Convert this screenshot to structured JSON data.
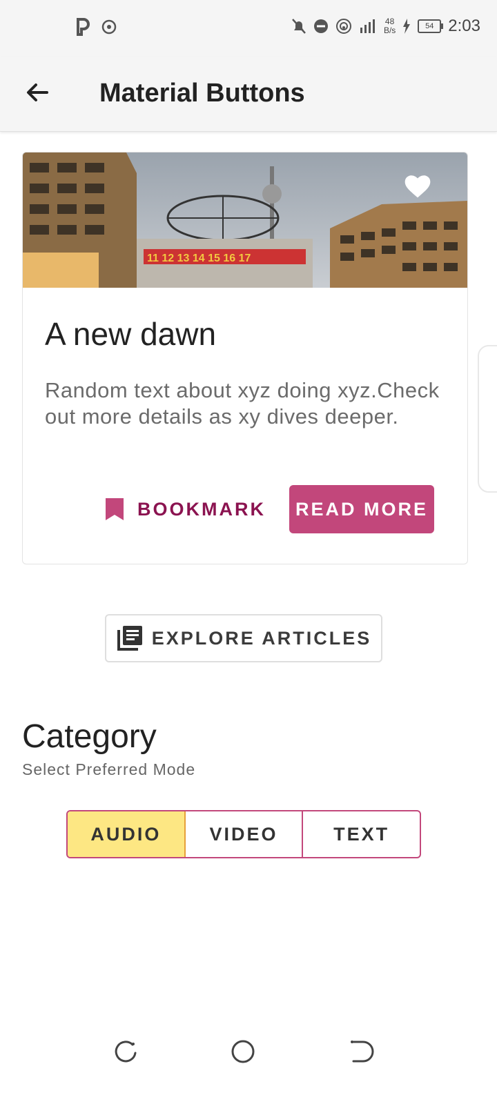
{
  "status_bar": {
    "time": "2:03",
    "speed_value": "48",
    "speed_unit": "B/s",
    "battery": "54"
  },
  "app_bar": {
    "title": "Material Buttons"
  },
  "card": {
    "title": "A new dawn",
    "body": "Random text about xyz doing xyz.Check out more details as xy dives deeper.",
    "bookmark_label": "BOOKMARK",
    "read_more_label": "READ MORE",
    "clock_digits": "11 12 13 14 15 16 17"
  },
  "explore_label": "EXPLORE ARTICLES",
  "category": {
    "title": "Category",
    "subtitle": "Select Preferred Mode",
    "options": [
      "AUDIO",
      "VIDEO",
      "TEXT"
    ],
    "selected": "AUDIO"
  },
  "colors": {
    "accent": "#c2477b",
    "bookmark": "#8b1350",
    "selected_toggle": "#fde783"
  }
}
